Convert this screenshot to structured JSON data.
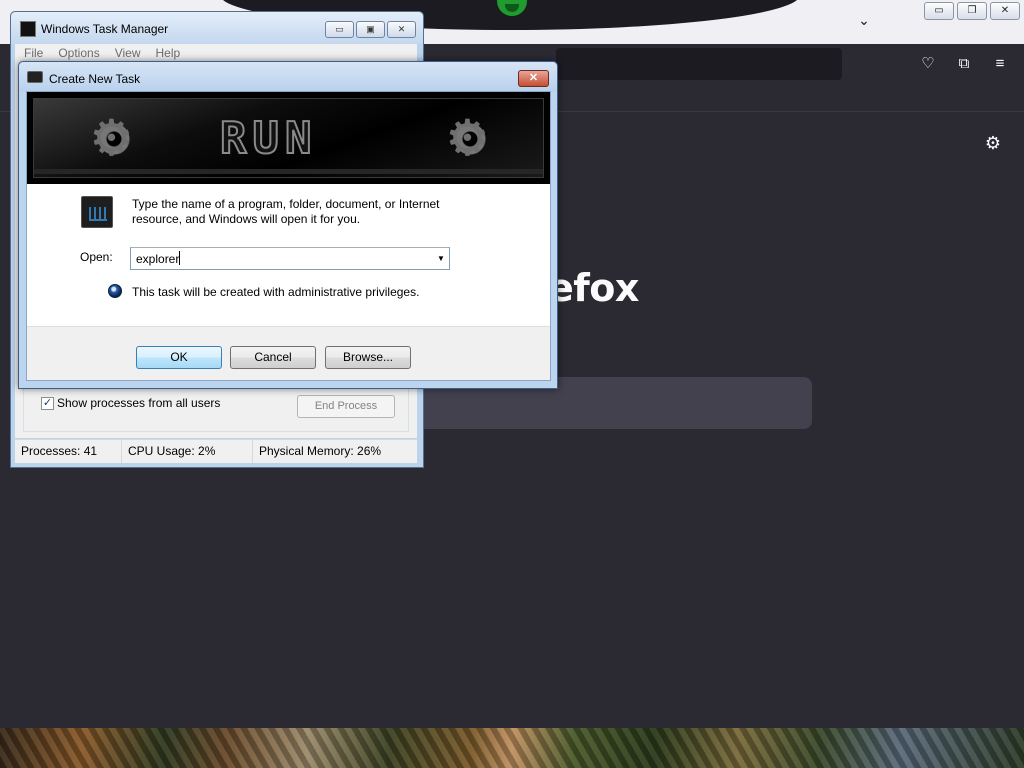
{
  "firefox": {
    "brand_fragment": "efox",
    "colors": {
      "background": "#2b2a33",
      "titlebar": "#f0f0f4",
      "search": "#42414d"
    },
    "icons": [
      "chevron-down-icon",
      "pocket-icon",
      "extensions-icon",
      "menu-icon",
      "gear-icon"
    ]
  },
  "task_manager": {
    "title": "Windows Task Manager",
    "window_buttons": [
      "▭",
      "▣",
      "✕"
    ],
    "menu": [
      "File",
      "Options",
      "View",
      "Help"
    ],
    "show_all_users_label": "Show processes from all users",
    "show_all_users_checked": true,
    "end_process_label": "End Process",
    "status": {
      "processes": "Processes: 41",
      "cpu": "CPU Usage: 2%",
      "memory": "Physical Memory: 26%"
    }
  },
  "dialog": {
    "title": "Create New Task",
    "close_symbol": "✕",
    "banner_text": "RUN",
    "description": "Type the name of a program, folder, document, or Internet resource, and Windows will open it for you.",
    "open_label": "Open:",
    "open_value": "explorer",
    "admin_note": "This task will be created with administrative privileges.",
    "buttons": {
      "ok": "OK",
      "cancel": "Cancel",
      "browse": "Browse..."
    }
  }
}
